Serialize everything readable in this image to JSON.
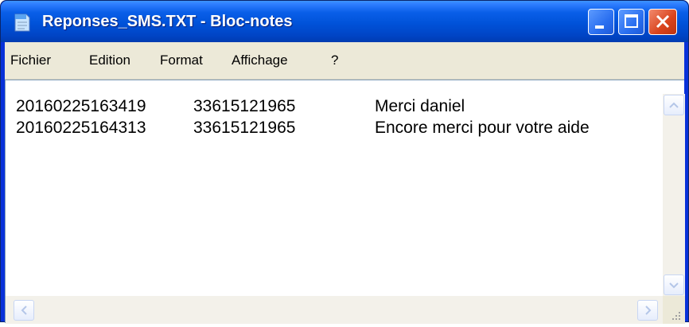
{
  "window": {
    "title": "Reponses_SMS.TXT - Bloc-notes",
    "app_icon": "notepad-icon",
    "controls": [
      "minimize-icon",
      "maximize-icon",
      "close-icon"
    ]
  },
  "menu": {
    "items": [
      "Fichier",
      "Edition",
      "Format",
      "Affichage",
      "?"
    ]
  },
  "document": {
    "lines": [
      {
        "timestamp": "20160225163419",
        "phone": "33615121965",
        "message": "Merci daniel"
      },
      {
        "timestamp": "20160225164313",
        "phone": "33615121965",
        "message": "Encore merci pour votre aide"
      }
    ]
  },
  "scrollbars": {
    "vertical_icons": [
      "scroll-up-icon",
      "scroll-down-icon"
    ],
    "horizontal_icons": [
      "scroll-left-icon",
      "scroll-right-icon"
    ]
  },
  "colors": {
    "titlebar": "#0052d9",
    "menubar": "#ece9d8",
    "close_button": "#d9431c"
  }
}
